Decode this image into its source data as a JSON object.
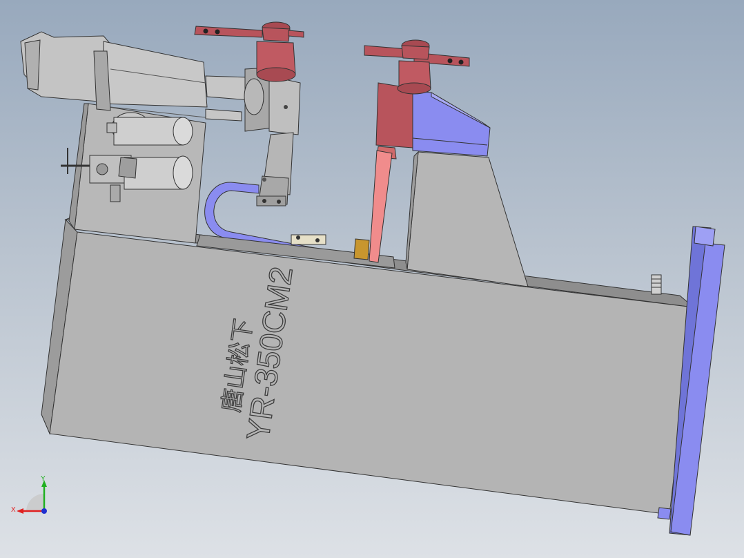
{
  "model": {
    "engraving_line1": "唐山松下",
    "engraving_line2": "YR-350CM2"
  },
  "triad": {
    "x_label": "X",
    "y_label": "Y",
    "x_color": "#e02020",
    "y_color": "#20b020",
    "z_color": "#2030d0"
  },
  "colors": {
    "body": "#b4b4b4",
    "clamp_handle": "#b8545c",
    "electrode": "#f08c8c",
    "insulator": "#8a8cf0",
    "contact_block": "#c8962e"
  }
}
